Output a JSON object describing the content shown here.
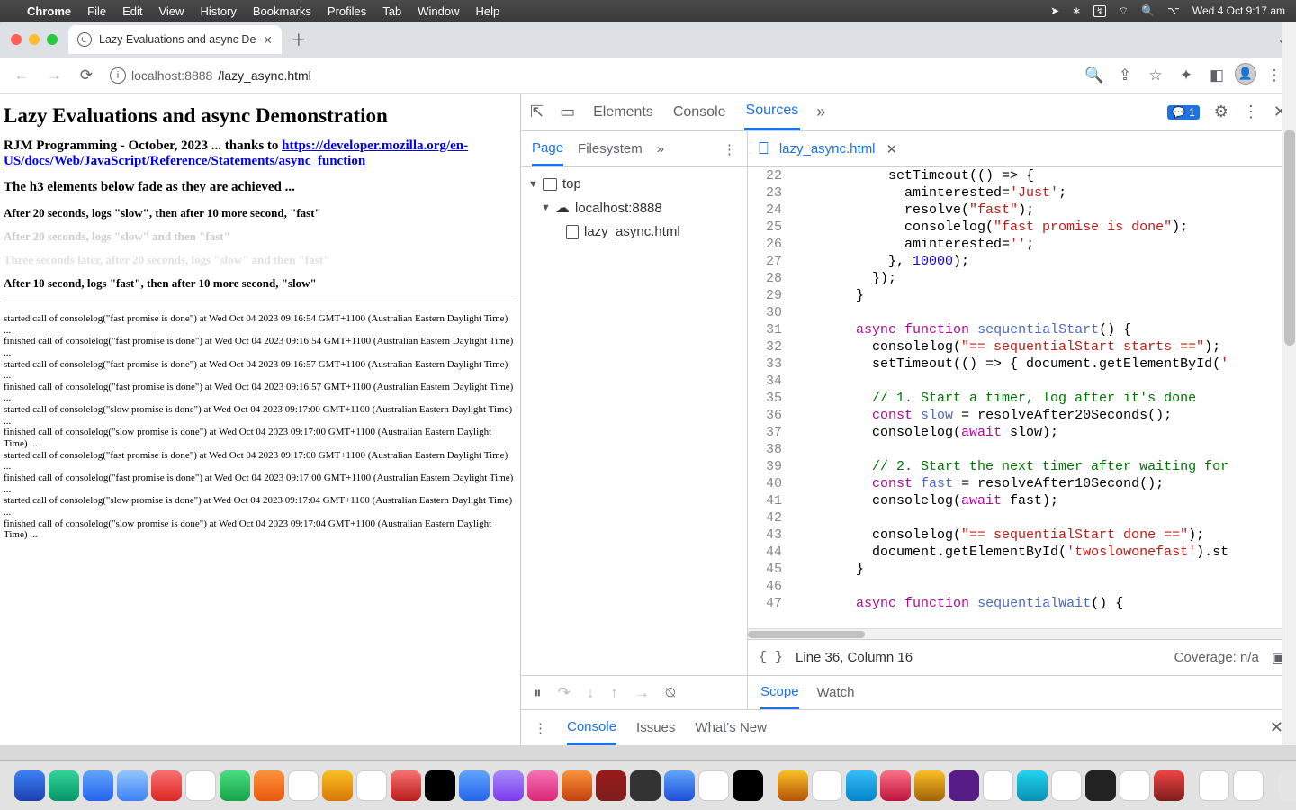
{
  "menubar": {
    "app": "Chrome",
    "items": [
      "File",
      "Edit",
      "View",
      "History",
      "Bookmarks",
      "Profiles",
      "Tab",
      "Window",
      "Help"
    ],
    "clock": "Wed 4 Oct  9:17 am"
  },
  "browser": {
    "tab_title": "Lazy Evaluations and async De",
    "url_host": "localhost",
    "url_port": ":8888",
    "url_path": "/lazy_async.html"
  },
  "page": {
    "h1": "Lazy Evaluations and async Demonstration",
    "sub_prefix": "RJM Programming - October, 2023 ... thanks to ",
    "sub_link": "https://developer.mozilla.org/en-US/docs/Web/JavaScript/Reference/Statements/async_function",
    "h3": "The h3 elements below fade as they are achieved ...",
    "ach": [
      "After 20 seconds, logs \"slow\", then after 10 more second, \"fast\"",
      "After 20 seconds, logs \"slow\" and then \"fast\"",
      "Three seconds later, after 20 seconds, logs \"slow\" and then \"fast\"",
      "After 10 second, logs \"fast\", then after 10 more second, \"slow\""
    ],
    "logs": [
      "started call of consolelog(\"fast promise is done\") at Wed Oct 04 2023 09:16:54 GMT+1100 (Australian Eastern Daylight Time) ...",
      "finished call of consolelog(\"fast promise is done\") at Wed Oct 04 2023 09:16:54 GMT+1100 (Australian Eastern Daylight Time) ...",
      "started call of consolelog(\"fast promise is done\") at Wed Oct 04 2023 09:16:57 GMT+1100 (Australian Eastern Daylight Time) ...",
      "finished call of consolelog(\"fast promise is done\") at Wed Oct 04 2023 09:16:57 GMT+1100 (Australian Eastern Daylight Time) ...",
      "started call of consolelog(\"slow promise is done\") at Wed Oct 04 2023 09:17:00 GMT+1100 (Australian Eastern Daylight Time) ...",
      "finished call of consolelog(\"slow promise is done\") at Wed Oct 04 2023 09:17:00 GMT+1100 (Australian Eastern Daylight Time) ...",
      "started call of consolelog(\"fast promise is done\") at Wed Oct 04 2023 09:17:00 GMT+1100 (Australian Eastern Daylight Time) ...",
      "finished call of consolelog(\"fast promise is done\") at Wed Oct 04 2023 09:17:00 GMT+1100 (Australian Eastern Daylight Time) ...",
      "started call of consolelog(\"slow promise is done\") at Wed Oct 04 2023 09:17:04 GMT+1100 (Australian Eastern Daylight Time) ...",
      "finished call of consolelog(\"slow promise is done\") at Wed Oct 04 2023 09:17:04 GMT+1100 (Australian Eastern Daylight Time) ..."
    ]
  },
  "devtools": {
    "tabs": {
      "elements": "Elements",
      "console": "Console",
      "sources": "Sources"
    },
    "badge": "1",
    "nav": {
      "page": "Page",
      "filesystem": "Filesystem",
      "top": "top",
      "origin": "localhost:8888",
      "file": "lazy_async.html"
    },
    "editor_file": "lazy_async.html",
    "status_line": "Line 36, Column 16",
    "coverage": "Coverage: n/a",
    "scope": "Scope",
    "watch": "Watch",
    "drawer": {
      "console": "Console",
      "issues": "Issues",
      "whatsnew": "What's New"
    },
    "code": [
      {
        "n": 22,
        "html": "            setTimeout<span class='op'>(() =&gt; {</span>"
      },
      {
        "n": 23,
        "html": "              aminterested=<span class='str'>'Just'</span>;"
      },
      {
        "n": 24,
        "html": "              resolve(<span class='str'>\"fast\"</span>);"
      },
      {
        "n": 25,
        "html": "              consolelog(<span class='str'>\"fast promise is done\"</span>);"
      },
      {
        "n": 26,
        "html": "              aminterested=<span class='str'>''</span>;"
      },
      {
        "n": 27,
        "html": "            }, <span class='num'>10000</span>);"
      },
      {
        "n": 28,
        "html": "          });"
      },
      {
        "n": 29,
        "html": "        }"
      },
      {
        "n": 30,
        "html": ""
      },
      {
        "n": 31,
        "html": "        <span class='kw'>async</span> <span class='kw'>function</span> <span class='fn'>sequentialStart</span>() {"
      },
      {
        "n": 32,
        "html": "          consolelog(<span class='str'>\"== sequentialStart starts ==\"</span>);"
      },
      {
        "n": 33,
        "html": "          setTimeout(() =&gt; { document.getElementById(<span class='str'>'</span>"
      },
      {
        "n": 34,
        "html": ""
      },
      {
        "n": 35,
        "html": "          <span class='cmt'>// 1. Start a timer, log after it's done</span>"
      },
      {
        "n": 36,
        "html": "          <span class='kw'>const</span> <span class='fn'>slow</span> = resolveAfter20Seconds();"
      },
      {
        "n": 37,
        "html": "          consolelog(<span class='kw'>await</span> slow);"
      },
      {
        "n": 38,
        "html": ""
      },
      {
        "n": 39,
        "html": "          <span class='cmt'>// 2. Start the next timer after waiting for</span>"
      },
      {
        "n": 40,
        "html": "          <span class='kw'>const</span> <span class='fn'>fast</span> = resolveAfter10Second();"
      },
      {
        "n": 41,
        "html": "          consolelog(<span class='kw'>await</span> fast);"
      },
      {
        "n": 42,
        "html": ""
      },
      {
        "n": 43,
        "html": "          consolelog(<span class='str'>\"== sequentialStart done ==\"</span>);"
      },
      {
        "n": 44,
        "html": "          document.getElementById(<span class='str'>'twoslowonefast'</span>).st"
      },
      {
        "n": 45,
        "html": "        }"
      },
      {
        "n": 46,
        "html": ""
      },
      {
        "n": 47,
        "html": "        <span class='kw'>async</span> <span class='kw'>function</span> <span class='fn'>sequentialWait</span>() {"
      }
    ]
  }
}
